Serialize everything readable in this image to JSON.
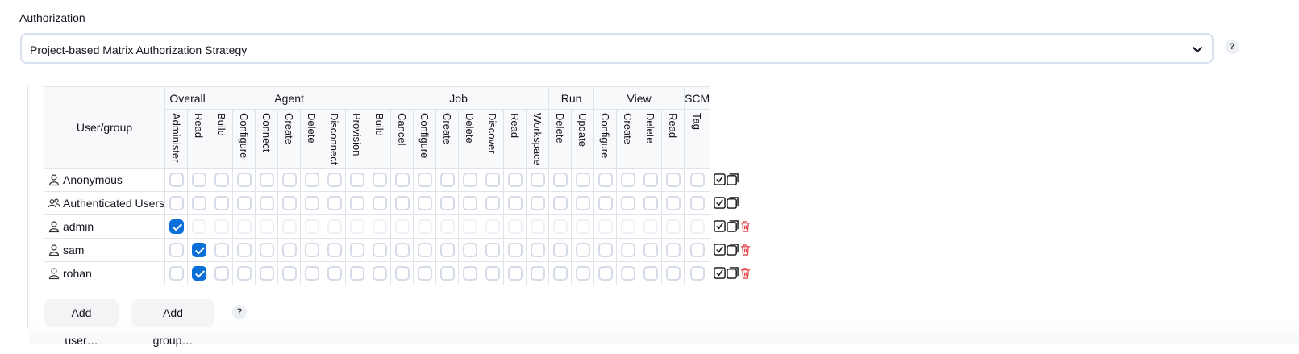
{
  "authorization": {
    "label": "Authorization",
    "strategy": "Project-based Matrix Authorization Strategy",
    "help": "?"
  },
  "matrix": {
    "user_group_header": "User/group",
    "groups": [
      {
        "name": "Overall",
        "perms": [
          "Administer",
          "Read"
        ]
      },
      {
        "name": "Agent",
        "perms": [
          "Build",
          "Configure",
          "Connect",
          "Create",
          "Delete",
          "Disconnect",
          "Provision"
        ]
      },
      {
        "name": "Job",
        "perms": [
          "Build",
          "Cancel",
          "Configure",
          "Create",
          "Delete",
          "Discover",
          "Read",
          "Workspace"
        ]
      },
      {
        "name": "Run",
        "perms": [
          "Delete",
          "Update"
        ]
      },
      {
        "name": "View",
        "perms": [
          "Configure",
          "Create",
          "Delete",
          "Read"
        ]
      },
      {
        "name": "SCM",
        "perms": [
          "Tag"
        ]
      }
    ],
    "rows": [
      {
        "name": "Anonymous",
        "icon": "user-icon",
        "checked": [],
        "disabled_after_first": false,
        "deletable": false
      },
      {
        "name": "Authenticated Users",
        "icon": "users-icon",
        "checked": [],
        "disabled_after_first": false,
        "deletable": false
      },
      {
        "name": "admin",
        "icon": "user-icon",
        "checked": [
          0
        ],
        "disabled_after_first": true,
        "deletable": true
      },
      {
        "name": "sam",
        "icon": "user-icon",
        "checked": [
          1
        ],
        "disabled_after_first": false,
        "deletable": true
      },
      {
        "name": "rohan",
        "icon": "user-icon",
        "checked": [
          1
        ],
        "disabled_after_first": false,
        "deletable": true
      }
    ]
  },
  "buttons": {
    "add_user": "Add user…",
    "add_group": "Add group…",
    "help": "?"
  },
  "colors": {
    "accent": "#0b6fd9",
    "delete": "#e5484d"
  }
}
